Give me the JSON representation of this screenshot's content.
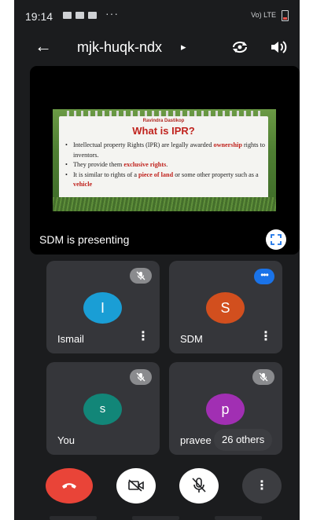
{
  "status_bar": {
    "time": "19:14",
    "overflow": "···",
    "network": "Vo) LTE"
  },
  "top_bar": {
    "meeting_code": "mjk-huqk-ndx",
    "caret": "▸",
    "icons": [
      "back-arrow-icon",
      "switch-camera-icon",
      "speaker-icon"
    ]
  },
  "presentation": {
    "presenting_text": "SDM is presenting",
    "slide": {
      "author": "Ravindra Dastikop",
      "title": "What is IPR?",
      "bullets": [
        {
          "pre": "Intellectual property Rights (IPR) are legally awarded ",
          "hl": "ownership",
          "post": " rights to inventors."
        },
        {
          "pre": "They provide them ",
          "hl": "exclusive rights",
          "post": "."
        },
        {
          "pre": "It is similar to rights of a ",
          "hl": "piece of land",
          "post": " or some other property such as a "
        },
        {
          "pre": "",
          "hl": "vehicle",
          "post": ""
        }
      ]
    }
  },
  "participants": [
    {
      "name": "Ismail",
      "initial": "I",
      "color": "#1a9ed5",
      "status": "muted"
    },
    {
      "name": "SDM",
      "initial": "S",
      "color": "#d24f1e",
      "status": "speaking"
    },
    {
      "name": "You",
      "initial": "s",
      "color": "#128678",
      "status": "muted"
    },
    {
      "name": "pravee",
      "initial": "p",
      "color": "#a12fb3",
      "status": "muted"
    }
  ],
  "others_pill": "26 others",
  "controls": {
    "more_label": "⋮",
    "buttons": [
      "end-call",
      "camera-off",
      "mic-off",
      "more-options"
    ]
  },
  "tile_menu_label": "⋮",
  "speaking_dots": "•••",
  "colors": {
    "end_call": "#e94438",
    "speaking": "#1a73e8",
    "background": "#1b1c1e"
  }
}
